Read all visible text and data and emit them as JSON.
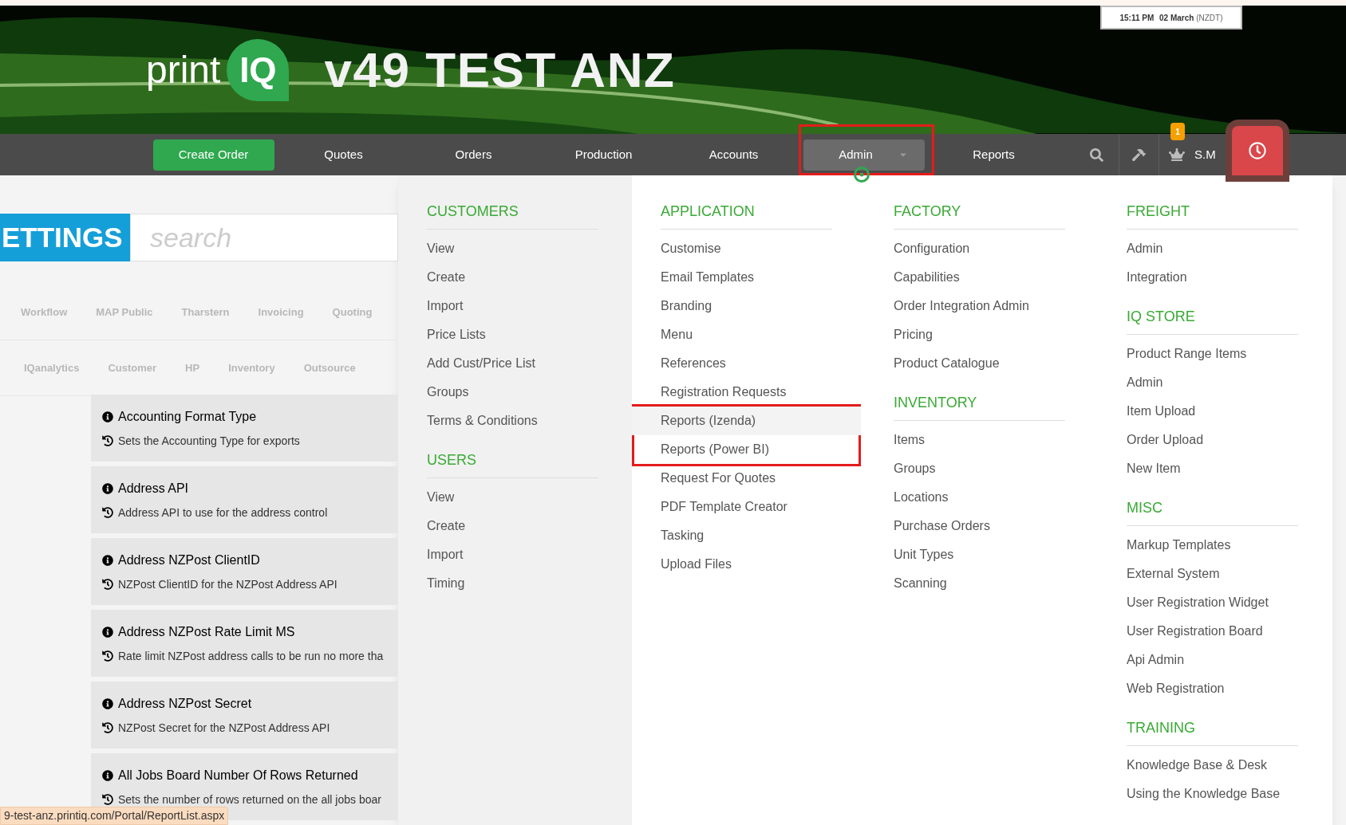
{
  "header": {
    "logo_text": "print",
    "logo_badge": "IQ",
    "title": "v49 TEST ANZ",
    "clock": {
      "time": "15:11 PM",
      "date": "02 March",
      "zone": "(NZDT)"
    }
  },
  "nav": {
    "items": [
      {
        "label": "Create Order",
        "kind": "primary",
        "selected": false,
        "annotated": false
      },
      {
        "label": "Quotes",
        "kind": "link",
        "selected": false,
        "annotated": false
      },
      {
        "label": "Orders",
        "kind": "link",
        "selected": false,
        "annotated": false
      },
      {
        "label": "Production",
        "kind": "link",
        "selected": false,
        "annotated": false
      },
      {
        "label": "Accounts",
        "kind": "link",
        "selected": false,
        "annotated": false
      },
      {
        "label": "Admin",
        "kind": "dropdown",
        "selected": true,
        "annotated": true
      },
      {
        "label": "Reports",
        "kind": "link",
        "selected": false,
        "annotated": false
      }
    ],
    "user": {
      "initials": "S.M",
      "badge": "1"
    }
  },
  "settings": {
    "title": "ETTINGS",
    "search_placeholder": "search",
    "tab_rows": [
      [
        "Workflow",
        "MAP Public",
        "Tharstern",
        "Invoicing",
        "Quoting"
      ],
      [
        "IQanalytics",
        "Customer",
        "HP",
        "Inventory",
        "Outsource"
      ]
    ],
    "cards": [
      {
        "title": "Accounting Format Type",
        "description": "Sets the Accounting Type for exports"
      },
      {
        "title": "Address API",
        "description": "Address API to use for the address control"
      },
      {
        "title": "Address NZPost ClientID",
        "description": "NZPost ClientID for the NZPost Address API"
      },
      {
        "title": "Address NZPost Rate Limit MS",
        "description": "Rate limit NZPost address calls to be run no more tha"
      },
      {
        "title": "Address NZPost Secret",
        "description": "NZPost Secret for the NZPost Address API"
      },
      {
        "title": "All Jobs Board Number Of Rows Returned",
        "description": "Sets the number of rows returned on the all jobs boar"
      }
    ]
  },
  "status_url": "9-test-anz.printiq.com/Portal/ReportList.aspx",
  "menu": {
    "columns": [
      {
        "shaded": true,
        "sections": [
          {
            "heading": "CUSTOMERS",
            "items": [
              {
                "label": "View",
                "hovered": false,
                "annotated": false
              },
              {
                "label": "Create",
                "hovered": false,
                "annotated": false
              },
              {
                "label": "Import",
                "hovered": false,
                "annotated": false
              },
              {
                "label": "Price Lists",
                "hovered": false,
                "annotated": false
              },
              {
                "label": "Add Cust/Price List",
                "hovered": false,
                "annotated": false
              },
              {
                "label": "Groups",
                "hovered": false,
                "annotated": false
              },
              {
                "label": "Terms & Conditions",
                "hovered": false,
                "annotated": false
              }
            ]
          },
          {
            "heading": "USERS",
            "items": [
              {
                "label": "View",
                "hovered": false,
                "annotated": false
              },
              {
                "label": "Create",
                "hovered": false,
                "annotated": false
              },
              {
                "label": "Import",
                "hovered": false,
                "annotated": false
              },
              {
                "label": "Timing",
                "hovered": false,
                "annotated": false
              }
            ]
          }
        ]
      },
      {
        "shaded": false,
        "sections": [
          {
            "heading": "APPLICATION",
            "items": [
              {
                "label": "Customise",
                "hovered": false,
                "annotated": false
              },
              {
                "label": "Email Templates",
                "hovered": false,
                "annotated": false
              },
              {
                "label": "Branding",
                "hovered": false,
                "annotated": false
              },
              {
                "label": "Menu",
                "hovered": false,
                "annotated": false
              },
              {
                "label": "References",
                "hovered": false,
                "annotated": false
              },
              {
                "label": "Registration Requests",
                "hovered": false,
                "annotated": false
              },
              {
                "label": "Reports (Izenda)",
                "hovered": true,
                "annotated": true
              },
              {
                "label": "Reports (Power BI)",
                "hovered": false,
                "annotated": true
              },
              {
                "label": "Request For Quotes",
                "hovered": false,
                "annotated": false
              },
              {
                "label": "PDF Template Creator",
                "hovered": false,
                "annotated": false
              },
              {
                "label": "Tasking",
                "hovered": false,
                "annotated": false
              },
              {
                "label": "Upload Files",
                "hovered": false,
                "annotated": false
              }
            ]
          }
        ]
      },
      {
        "shaded": false,
        "sections": [
          {
            "heading": "FACTORY",
            "items": [
              {
                "label": "Configuration",
                "hovered": false,
                "annotated": false
              },
              {
                "label": "Capabilities",
                "hovered": false,
                "annotated": false
              },
              {
                "label": "Order Integration Admin",
                "hovered": false,
                "annotated": false
              },
              {
                "label": "Pricing",
                "hovered": false,
                "annotated": false
              },
              {
                "label": "Product Catalogue",
                "hovered": false,
                "annotated": false
              }
            ]
          },
          {
            "heading": "INVENTORY",
            "items": [
              {
                "label": "Items",
                "hovered": false,
                "annotated": false
              },
              {
                "label": "Groups",
                "hovered": false,
                "annotated": false
              },
              {
                "label": "Locations",
                "hovered": false,
                "annotated": false
              },
              {
                "label": "Purchase Orders",
                "hovered": false,
                "annotated": false
              },
              {
                "label": "Unit Types",
                "hovered": false,
                "annotated": false
              },
              {
                "label": "Scanning",
                "hovered": false,
                "annotated": false
              }
            ]
          }
        ]
      },
      {
        "shaded": false,
        "sections": [
          {
            "heading": "FREIGHT",
            "items": [
              {
                "label": "Admin",
                "hovered": false,
                "annotated": false
              },
              {
                "label": "Integration",
                "hovered": false,
                "annotated": false
              }
            ]
          },
          {
            "heading": "IQ STORE",
            "items": [
              {
                "label": "Product Range Items",
                "hovered": false,
                "annotated": false
              },
              {
                "label": "Admin",
                "hovered": false,
                "annotated": false
              },
              {
                "label": "Item Upload",
                "hovered": false,
                "annotated": false
              },
              {
                "label": "Order Upload",
                "hovered": false,
                "annotated": false
              },
              {
                "label": "New Item",
                "hovered": false,
                "annotated": false
              }
            ]
          },
          {
            "heading": "MISC",
            "items": [
              {
                "label": "Markup Templates",
                "hovered": false,
                "annotated": false
              },
              {
                "label": "External System",
                "hovered": false,
                "annotated": false
              },
              {
                "label": "User Registration Widget",
                "hovered": false,
                "annotated": false
              },
              {
                "label": "User Registration Board",
                "hovered": false,
                "annotated": false
              },
              {
                "label": "Api Admin",
                "hovered": false,
                "annotated": false
              },
              {
                "label": "Web Registration",
                "hovered": false,
                "annotated": false
              }
            ]
          },
          {
            "heading": "TRAINING",
            "items": [
              {
                "label": "Knowledge Base & Desk",
                "hovered": false,
                "annotated": false
              },
              {
                "label": "Using the Knowledge Base",
                "hovered": false,
                "annotated": false
              }
            ]
          }
        ]
      }
    ]
  }
}
